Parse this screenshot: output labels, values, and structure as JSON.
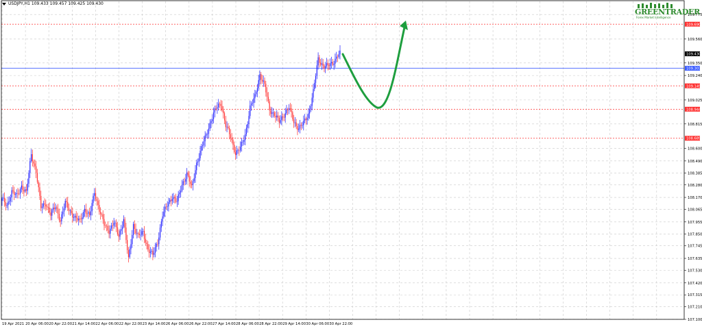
{
  "header": {
    "symbol": "USDJPY,H1",
    "ohlc": "109.433 109.457 109.425 109.430"
  },
  "logo": {
    "brand": "GREENTRADER",
    "tagline": "Forex Market Intelligence"
  },
  "colors": {
    "bull": "#1a1aff",
    "bear": "#ff2a2a",
    "grid": "#c8c8c8",
    "level_red": "#ff3030",
    "level_blue": "#3a5bff",
    "arrow": "#1e9e3e",
    "current_price_bg": "#000000"
  },
  "chart_data": {
    "type": "candlestick",
    "ylim": [
      107.1,
      109.83
    ],
    "y_ticks": [
      "109.775",
      "109.560",
      "109.350",
      "109.240",
      "109.025",
      "108.815",
      "108.600",
      "108.490",
      "108.385",
      "108.280",
      "108.170",
      "108.065",
      "107.955",
      "107.850",
      "107.745",
      "107.635",
      "107.530",
      "107.420",
      "107.315",
      "107.210",
      "107.100"
    ],
    "x_tick_labels": [
      "19 Apr 2021",
      "20 Apr 06:00",
      "20 Apr 22:00",
      "21 Apr 14:00",
      "22 Apr 06:00",
      "22 Apr 22:00",
      "23 Apr 14:00",
      "26 Apr 06:00",
      "26 Apr 22:00",
      "27 Apr 14:00",
      "28 Apr 06:00",
      "28 Apr 22:00",
      "29 Apr 14:00",
      "30 Apr 06:00",
      "30 Apr 22:00"
    ],
    "levels": [
      {
        "price": 109.69,
        "label": "109.690",
        "color": "red",
        "style": "dotted"
      },
      {
        "price": 109.303,
        "label": "109.303",
        "color": "blue",
        "style": "solid"
      },
      {
        "price": 109.149,
        "label": "109.149",
        "color": "red",
        "style": "dotted"
      },
      {
        "price": 108.944,
        "label": "108.944",
        "color": "red",
        "style": "dotted"
      },
      {
        "price": 108.689,
        "label": "108.689",
        "color": "red",
        "style": "dotted"
      }
    ],
    "current_price": {
      "price": 109.43,
      "label": "109.430"
    },
    "anchors": [
      [
        0,
        108.15
      ],
      [
        4,
        108.1
      ],
      [
        8,
        108.22
      ],
      [
        12,
        108.18
      ],
      [
        16,
        108.27
      ],
      [
        20,
        108.21
      ],
      [
        24,
        108.55
      ],
      [
        28,
        108.4
      ],
      [
        32,
        108.08
      ],
      [
        36,
        108.12
      ],
      [
        40,
        108.02
      ],
      [
        44,
        108.09
      ],
      [
        48,
        107.97
      ],
      [
        52,
        108.12
      ],
      [
        56,
        108.05
      ],
      [
        60,
        107.99
      ],
      [
        64,
        107.96
      ],
      [
        68,
        108.07
      ],
      [
        72,
        108.0
      ],
      [
        76,
        108.22
      ],
      [
        80,
        108.06
      ],
      [
        84,
        107.93
      ],
      [
        88,
        107.88
      ],
      [
        92,
        107.95
      ],
      [
        96,
        107.83
      ],
      [
        100,
        107.98
      ],
      [
        104,
        107.62
      ],
      [
        108,
        107.93
      ],
      [
        112,
        107.83
      ],
      [
        116,
        107.86
      ],
      [
        120,
        107.72
      ],
      [
        124,
        107.66
      ],
      [
        128,
        107.78
      ],
      [
        132,
        108.02
      ],
      [
        136,
        108.1
      ],
      [
        140,
        108.18
      ],
      [
        144,
        108.13
      ],
      [
        148,
        108.28
      ],
      [
        152,
        108.38
      ],
      [
        156,
        108.25
      ],
      [
        160,
        108.47
      ],
      [
        164,
        108.6
      ],
      [
        168,
        108.72
      ],
      [
        172,
        108.85
      ],
      [
        176,
        108.95
      ],
      [
        180,
        109.0
      ],
      [
        184,
        108.8
      ],
      [
        188,
        108.7
      ],
      [
        192,
        108.56
      ],
      [
        196,
        108.6
      ],
      [
        200,
        108.72
      ],
      [
        204,
        108.96
      ],
      [
        208,
        109.05
      ],
      [
        212,
        109.25
      ],
      [
        216,
        109.15
      ],
      [
        220,
        108.94
      ],
      [
        224,
        108.9
      ],
      [
        228,
        108.83
      ],
      [
        232,
        108.9
      ],
      [
        236,
        108.96
      ],
      [
        240,
        108.83
      ],
      [
        244,
        108.78
      ],
      [
        248,
        108.82
      ],
      [
        252,
        108.9
      ],
      [
        256,
        109.1
      ],
      [
        260,
        109.38
      ],
      [
        264,
        109.33
      ],
      [
        268,
        109.32
      ],
      [
        272,
        109.35
      ],
      [
        276,
        109.42
      ],
      [
        278,
        109.43
      ]
    ]
  }
}
